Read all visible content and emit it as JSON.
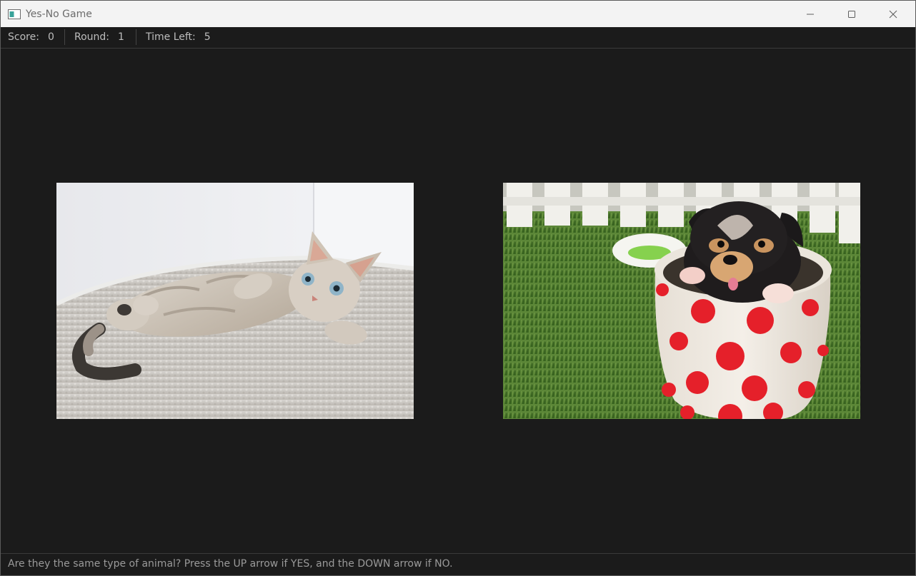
{
  "window": {
    "title": "Yes-No Game"
  },
  "status": {
    "score_label": "Score:",
    "score_value": "0",
    "round_label": "Round:",
    "round_value": "1",
    "time_label": "Time Left:",
    "time_value": "5"
  },
  "images": {
    "left": {
      "subject": "kitten lying on a fluffy white blanket",
      "icon": "cat-photo"
    },
    "right": {
      "subject": "puppy in a red polka-dot cup on grass",
      "icon": "dog-photo"
    }
  },
  "instructions": "Are they the same type of animal? Press the UP arrow if YES, and the DOWN arrow if NO.",
  "colors": {
    "background": "#1b1b1b",
    "titlebar": "#f3f3f3",
    "text": "#bdbdbd",
    "cup_dots": "#e5202a"
  }
}
